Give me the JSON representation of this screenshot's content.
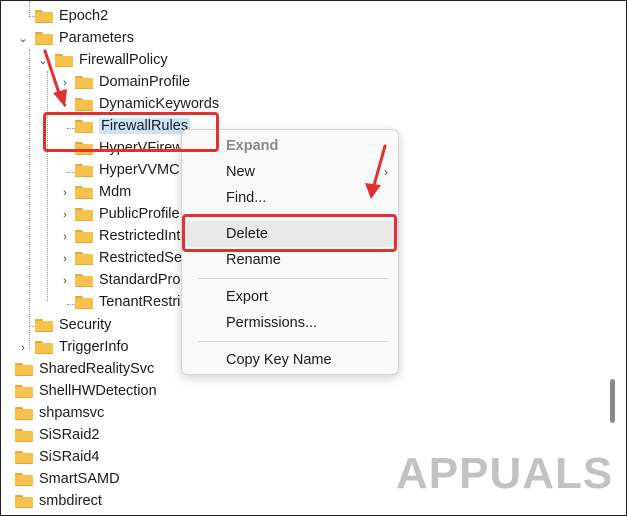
{
  "tree": {
    "items": [
      {
        "label": "Epoch2"
      },
      {
        "label": "Parameters"
      },
      {
        "label": "FirewallPolicy"
      },
      {
        "label": "DomainProfile"
      },
      {
        "label": "DynamicKeywords"
      },
      {
        "label": "FirewallRules"
      },
      {
        "label": "HyperVFirew"
      },
      {
        "label": "HyperVVMC"
      },
      {
        "label": "Mdm"
      },
      {
        "label": "PublicProfile"
      },
      {
        "label": "RestrictedInt"
      },
      {
        "label": "RestrictedSe"
      },
      {
        "label": "StandardPro"
      },
      {
        "label": "TenantRestri"
      },
      {
        "label": "Security"
      },
      {
        "label": "TriggerInfo"
      },
      {
        "label": "SharedRealitySvc"
      },
      {
        "label": "ShellHWDetection"
      },
      {
        "label": "shpamsvc"
      },
      {
        "label": "SiSRaid2"
      },
      {
        "label": "SiSRaid4"
      },
      {
        "label": "SmartSAMD"
      },
      {
        "label": "smbdirect"
      }
    ]
  },
  "context_menu": {
    "expand": "Expand",
    "new": "New",
    "find": "Find...",
    "delete": "Delete",
    "rename": "Rename",
    "export": "Export",
    "permissions": "Permissions...",
    "copy_key_name": "Copy Key Name"
  },
  "watermark": "APPUALS",
  "colors": {
    "highlight": "#e03030",
    "selection": "#cce4f7",
    "folder": "#f6c24c"
  }
}
